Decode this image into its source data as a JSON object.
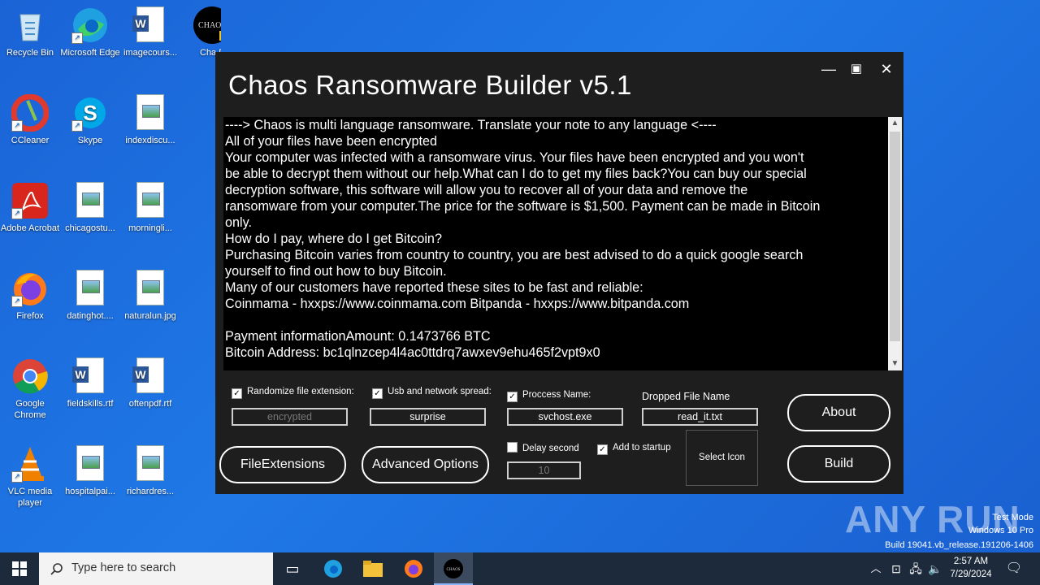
{
  "desktop": {
    "icons": [
      {
        "label": "Recycle Bin",
        "icon": "recycle-bin-icon"
      },
      {
        "label": "Microsoft Edge",
        "icon": "edge-icon"
      },
      {
        "label": "imagecours...",
        "icon": "word-doc-icon"
      },
      {
        "label": "Cha Ransom",
        "icon": "chaos-icon"
      },
      {
        "label": "CCleaner",
        "icon": "ccleaner-icon"
      },
      {
        "label": "Skype",
        "icon": "skype-icon"
      },
      {
        "label": "indexdiscu...",
        "icon": "image-file-icon"
      },
      {
        "label": "Adobe Acrobat",
        "icon": "acrobat-icon"
      },
      {
        "label": "chicagostu...",
        "icon": "image-file-icon"
      },
      {
        "label": "morningli...",
        "icon": "image-file-icon"
      },
      {
        "label": "Firefox",
        "icon": "firefox-icon"
      },
      {
        "label": "datinghot....",
        "icon": "image-file-icon"
      },
      {
        "label": "naturalun.jpg",
        "icon": "image-file-icon"
      },
      {
        "label": "Google Chrome",
        "icon": "chrome-icon"
      },
      {
        "label": "fieldskills.rtf",
        "icon": "word-doc-icon"
      },
      {
        "label": "oftenpdf.rtf",
        "icon": "word-doc-icon"
      },
      {
        "label": "VLC media player",
        "icon": "vlc-icon"
      },
      {
        "label": "hospitalpai...",
        "icon": "image-file-icon"
      },
      {
        "label": "richardres...",
        "icon": "image-file-icon"
      }
    ]
  },
  "window": {
    "title": "Chaos Ransomware Builder v5.1",
    "controls": {
      "minimize": "—",
      "maximize": "▣",
      "close": "✕"
    },
    "note_lines": [
      "----> Chaos is multi language ransomware. Translate your note to any language <----",
      "All of your files have been encrypted",
      "Your computer was infected with a ransomware virus. Your files have been encrypted and you won't",
      "be able to decrypt them without our help.What can I do to get my files back?You can buy our special",
      "decryption software, this software will allow you to recover all of your data and remove the",
      "ransomware from your computer.The price for the software is $1,500. Payment can be made in Bitcoin",
      "only.",
      "How do I pay, where do I get Bitcoin?",
      "Purchasing Bitcoin varies from country to country, you are best advised to do a quick google search",
      "yourself  to find out how to buy Bitcoin.",
      "Many of our customers have reported these sites to be fast and reliable:",
      "Coinmama - hxxps://www.coinmama.com Bitpanda - hxxps://www.bitpanda.com",
      "",
      "Payment informationAmount: 0.1473766 BTC",
      "Bitcoin Address:  bc1qlnzcep4l4ac0ttdrq7awxev9ehu465f2vpt9x0"
    ],
    "options": {
      "randomize_label": "Randomize file extension:",
      "randomize_value": "encrypted",
      "usb_label": "Usb and network spread:",
      "usb_value": "surprise",
      "process_label": "Proccess Name:",
      "process_value": "svchost.exe",
      "dropped_label": "Dropped File Name",
      "dropped_value": "read_it.txt",
      "delay_label": "Delay second",
      "delay_value": "10",
      "startup_label": "Add to startup",
      "select_icon": "Select Icon"
    },
    "buttons": {
      "file_extensions": "FileExtensions",
      "advanced": "Advanced Options",
      "about": "About",
      "build": "Build"
    }
  },
  "watermark": {
    "brand": "ANY RUN",
    "line1": "Test Mode",
    "line2": "Windows 10 Pro",
    "line3": "Build 19041.vb_release.191206-1406"
  },
  "taskbar": {
    "search_placeholder": "Type here to search",
    "time": "2:57 AM",
    "date": "7/29/2024"
  }
}
